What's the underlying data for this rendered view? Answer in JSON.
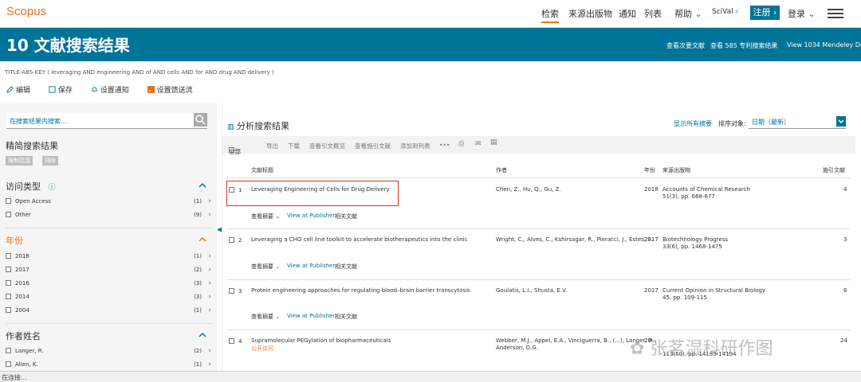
{
  "header": {
    "logo": "Scopus",
    "nav": [
      "检索",
      "来源出版物",
      "通知",
      "列表",
      "帮助",
      "SciVal",
      "注册",
      "登录"
    ],
    "nav_icons": [
      "",
      "",
      "",
      "",
      "chevron-down-icon",
      "chevron-right-icon",
      "chevron-right-icon",
      "chevron-down-icon"
    ]
  },
  "banner": {
    "title": "10 文献搜索结果",
    "links": [
      "查看次要文献",
      "查看 585 专利搜索结果",
      "View 1034 Mendeley Data"
    ]
  },
  "query": {
    "parts": [
      "TITLE-ABS-KEY",
      "(",
      "leveraging",
      "AND",
      "engineering",
      "AND",
      "of",
      "AND",
      "cells",
      "AND",
      "for",
      "AND",
      "drug",
      "AND",
      "delivery",
      ")"
    ]
  },
  "query_text": "TITLE-ABS-KEY ( leveraging AND engineering AND of AND cells AND for AND drug AND delivery )",
  "actions": [
    "编辑",
    "保存",
    "设置通知",
    "设置馈送流"
  ],
  "sidebar": {
    "search_placeholder": "在搜索结果内搜索...",
    "refine_title": "精简搜索结果",
    "tags": [
      "限制范围",
      "排除"
    ],
    "facets": [
      {
        "title": "访问类型",
        "items": [
          {
            "label": "Open Access",
            "count": "(1)"
          },
          {
            "label": "Other",
            "count": "(9)"
          }
        ]
      },
      {
        "title": "年份",
        "items": [
          {
            "label": "2018",
            "count": "(1)"
          },
          {
            "label": "2017",
            "count": "(2)"
          },
          {
            "label": "2016",
            "count": "(3)"
          },
          {
            "label": "2014",
            "count": "(3)"
          },
          {
            "label": "2004",
            "count": "(1)"
          }
        ]
      },
      {
        "title": "作者姓名",
        "items": [
          {
            "label": "Langer, R.",
            "count": "(2)"
          },
          {
            "label": "Allen, K.",
            "count": "(1)"
          }
        ]
      }
    ]
  },
  "main": {
    "title": "分析搜索结果",
    "show_abstracts": "显示所有摘要",
    "sort_label": "排序对象:",
    "sort_value": "日期（最新）",
    "toolbar": [
      "全部",
      "导出",
      "下载",
      "查看引文概览",
      "查看施引文献",
      "添加到列表",
      "•••"
    ],
    "columns": [
      "文献标题",
      "作者",
      "年份",
      "来源出版物",
      "施引文献"
    ],
    "rows": [
      {
        "num": "1",
        "title": "Leveraging Engineering of Cells for Drug Delivery",
        "authors": "Chen, Z., Hu, Q., Gu, Z.",
        "authors2": "",
        "year": "2018",
        "source": "Accounts of Chemical Research",
        "source2": "51(3), pp. 668-677",
        "cited": "4",
        "open_access": ""
      },
      {
        "num": "2",
        "title": "Leveraging a CHO cell line toolkit to accelerate biotherapeutics into the clinic",
        "authors": "Wright, C., Alves, C., Kshirsagar, R., Pieracci, J., Estes, S.",
        "authors2": "",
        "year": "2017",
        "source": "Biotechnology Progress",
        "source2": "33(6), pp. 1468-1475",
        "cited": "3",
        "open_access": ""
      },
      {
        "num": "3",
        "title": "Protein engineering approaches for regulating blood–brain barrier transcytosis",
        "authors": "Goulatis, L.I., Shusta, E.V.",
        "authors2": "",
        "year": "2017",
        "source": "Current Opinion in Structural Biology",
        "source2": "45, pp. 109-115",
        "cited": "6",
        "open_access": ""
      },
      {
        "num": "4",
        "title": "Supramolecular PEGylation of biopharmaceuticals",
        "authors": "Webber, M.J., Appel, E.A., Vinciguerra, B., (...), Langer, R.,",
        "authors2": "Anderson, D.G.",
        "year": "20",
        "source": "",
        "source2": "113(50), pp. 14189-14194",
        "cited": "24",
        "open_access": "公开访问"
      }
    ],
    "row_links": [
      "查看摘要",
      "View at Publisher",
      "相关文献"
    ]
  },
  "watermark": "张茗湿科研作图",
  "status": "在连接..."
}
